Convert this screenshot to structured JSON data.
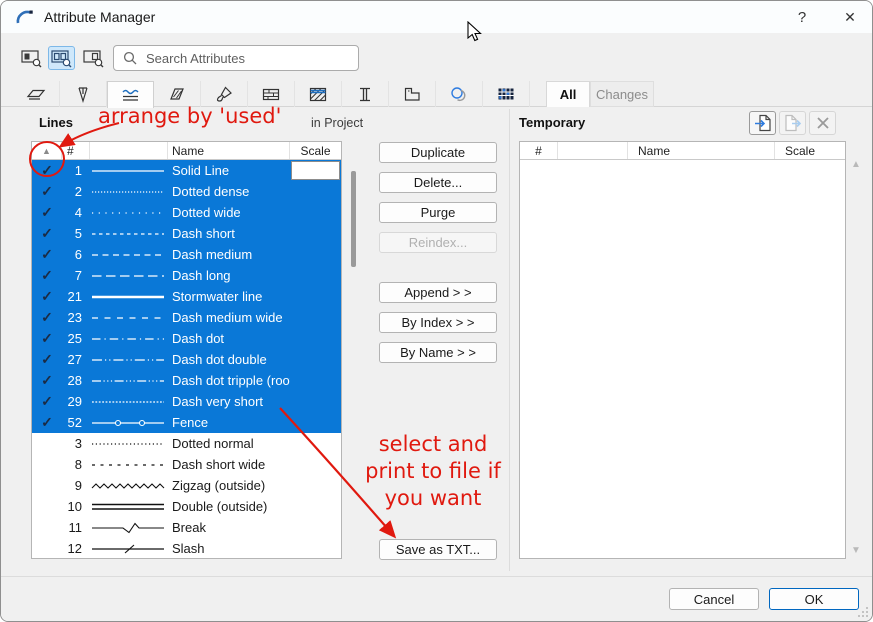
{
  "window": {
    "title": "Attribute Manager",
    "help_label": "?",
    "close_label": "✕"
  },
  "search": {
    "placeholder": "Search Attributes"
  },
  "tabs": {
    "icon_tabs": [
      "layers",
      "pen-sets",
      "line-types",
      "fill-types",
      "surfaces",
      "composites",
      "building-materials",
      "profiles",
      "zone-categories",
      "operation-profiles",
      "mep-systems"
    ],
    "selected_icon_tab": "line-types",
    "filter_all": "All",
    "filter_changes": "Changes"
  },
  "left_panel": {
    "title": "Lines",
    "context": "in Project",
    "header": {
      "num": "#",
      "name": "Name",
      "scale": "Scale"
    },
    "rows": [
      {
        "used": true,
        "selected": true,
        "num": "1",
        "style": "solid",
        "name": "Solid Line",
        "scale": "",
        "scale_editor": true
      },
      {
        "used": true,
        "selected": true,
        "num": "2",
        "style": "dotted_dense",
        "name": "Dotted dense",
        "scale": ""
      },
      {
        "used": true,
        "selected": true,
        "num": "4",
        "style": "dotted_wide",
        "name": "Dotted wide",
        "scale": ""
      },
      {
        "used": true,
        "selected": true,
        "num": "5",
        "style": "dash_short",
        "name": "Dash short",
        "scale": ""
      },
      {
        "used": true,
        "selected": true,
        "num": "6",
        "style": "dash_medium",
        "name": "Dash medium",
        "scale": ""
      },
      {
        "used": true,
        "selected": true,
        "num": "7",
        "style": "dash_long",
        "name": "Dash long",
        "scale": ""
      },
      {
        "used": true,
        "selected": true,
        "num": "21",
        "style": "solid_thick",
        "name": "Stormwater line",
        "scale": ""
      },
      {
        "used": true,
        "selected": true,
        "num": "23",
        "style": "dash_medium_wide",
        "name": "Dash medium wide",
        "scale": ""
      },
      {
        "used": true,
        "selected": true,
        "num": "25",
        "style": "dash_dot",
        "name": "Dash dot",
        "scale": ""
      },
      {
        "used": true,
        "selected": true,
        "num": "27",
        "style": "dash_dot_double",
        "name": "Dash dot double",
        "scale": ""
      },
      {
        "used": true,
        "selected": true,
        "num": "28",
        "style": "dash_dot_triple",
        "name": "Dash dot tripple (roof)",
        "scale": ""
      },
      {
        "used": true,
        "selected": true,
        "num": "29",
        "style": "dash_very_short",
        "name": "Dash very short",
        "scale": ""
      },
      {
        "used": true,
        "selected": true,
        "num": "52",
        "style": "fence",
        "name": "Fence",
        "scale": ""
      },
      {
        "used": false,
        "selected": false,
        "num": "3",
        "style": "dotted_normal",
        "name": "Dotted normal",
        "scale": ""
      },
      {
        "used": false,
        "selected": false,
        "num": "8",
        "style": "dash_short_wide",
        "name": "Dash short wide",
        "scale": ""
      },
      {
        "used": false,
        "selected": false,
        "num": "9",
        "style": "zigzag",
        "name": "Zigzag (outside)",
        "scale": ""
      },
      {
        "used": false,
        "selected": false,
        "num": "10",
        "style": "double",
        "name": "Double (outside)",
        "scale": ""
      },
      {
        "used": false,
        "selected": false,
        "num": "11",
        "style": "break",
        "name": "Break",
        "scale": ""
      },
      {
        "used": false,
        "selected": false,
        "num": "12",
        "style": "slash",
        "name": "Slash",
        "scale": ""
      }
    ]
  },
  "middle": {
    "duplicate": "Duplicate",
    "delete": "Delete...",
    "purge": "Purge",
    "reindex": "Reindex...",
    "append": "Append > >",
    "by_index": "By Index > >",
    "by_name": "By Name > >",
    "save_txt": "Save as TXT..."
  },
  "right_panel": {
    "title": "Temporary",
    "header": {
      "num": "#",
      "name": "Name",
      "scale": "Scale"
    }
  },
  "annotations": {
    "arrange": "arrange by 'used'",
    "select_line1": "select and",
    "select_line2": "print to file if",
    "select_line3": "you want"
  },
  "footer": {
    "cancel": "Cancel",
    "ok": "OK"
  },
  "colors": {
    "selection": "#0a78d7",
    "annotation_red": "#e0190f",
    "ok_border": "#0067c0",
    "check": "#1b2b44"
  }
}
